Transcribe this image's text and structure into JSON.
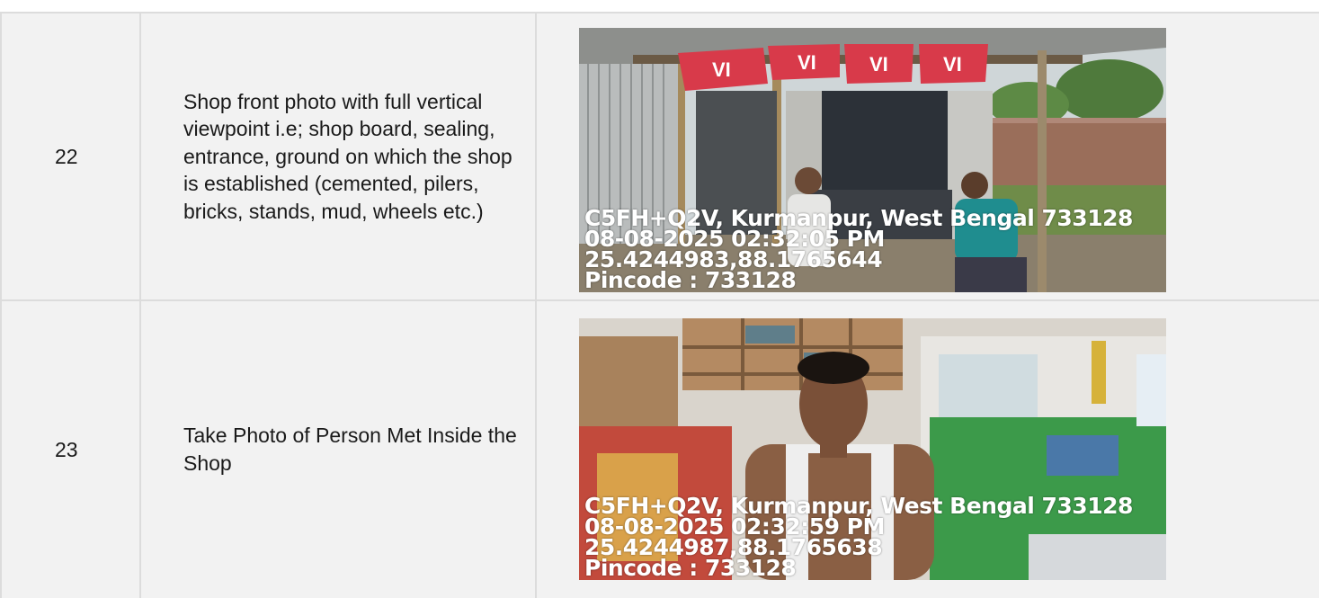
{
  "rows": [
    {
      "number": "22",
      "description": "Shop front photo with full vertical viewpoint i.e; shop board, sealing, entrance, ground on which the shop is established (cemented, pilers, bricks, stands, mud, wheels etc.)",
      "photo": {
        "subject": "shop-front",
        "overlay": [
          "C5FH+Q2V, Kurmanpur, West Bengal 733128",
          "08-08-2025 02:32:05 PM",
          "25.4244983,88.1765644",
          "Pincode : 733128"
        ],
        "banner_text": "VI"
      }
    },
    {
      "number": "23",
      "description": "Take Photo of Person Met Inside the Shop",
      "photo": {
        "subject": "person-inside-shop",
        "overlay": [
          "C5FH+Q2V, Kurmanpur, West Bengal 733128",
          "08-08-2025 02:32:59 PM",
          "25.4244987,88.1765638",
          "Pincode : 733128"
        ]
      }
    }
  ],
  "colors": {
    "row_bg": "#f2f2f2",
    "border": "#dcdcdc",
    "text": "#1a1a1a",
    "overlay_text": "#ffffff",
    "banner_red": "#d83a4a"
  }
}
